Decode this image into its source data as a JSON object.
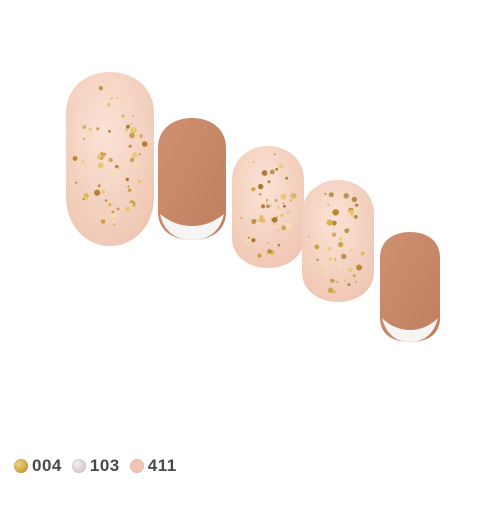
{
  "colors": {
    "glitter_base": "#f7d4c4",
    "glitter_flake": "#c89b3a",
    "matte_terracotta": "#c88868",
    "french_tip": "#f6f3f2"
  },
  "nails": [
    {
      "style": "glitter"
    },
    {
      "style": "matte-french"
    },
    {
      "style": "glitter"
    },
    {
      "style": "glitter"
    },
    {
      "style": "matte-french"
    }
  ],
  "swatches": [
    {
      "code": "004",
      "color": "#c5a14a",
      "finish": "gold-glitter"
    },
    {
      "code": "103",
      "color": "#d9cdd6",
      "finish": "pearl"
    },
    {
      "code": "411",
      "color": "#f0c3b3",
      "finish": "peach"
    }
  ]
}
